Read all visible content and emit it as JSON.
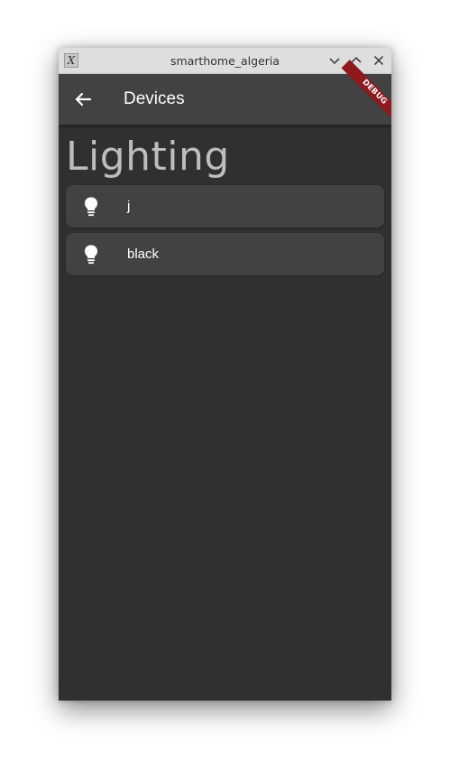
{
  "window": {
    "title": "smarthome_algeria",
    "app_icon_glyph": "X",
    "controls": {
      "minimize_icon": "chevron-down-icon",
      "maximize_icon": "chevron-up-icon",
      "close_icon": "close-icon"
    }
  },
  "appbar": {
    "back_icon": "arrow-back-icon",
    "title": "Devices",
    "debug_banner": "DEBUG"
  },
  "section": {
    "title": "Lighting"
  },
  "devices": [
    {
      "name": "j",
      "icon": "lightbulb-icon"
    },
    {
      "name": "black",
      "icon": "lightbulb-icon"
    }
  ],
  "colors": {
    "background": "#303030",
    "appbar": "#424242",
    "card": "#424242",
    "heading_text": "#bdbdbd",
    "debug_banner": "#8e1a1e"
  }
}
